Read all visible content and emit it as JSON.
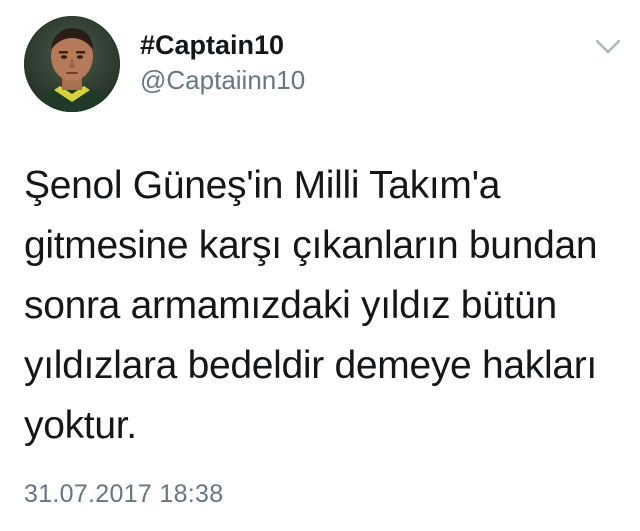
{
  "user": {
    "display_name": "#Captain10",
    "handle": "@Captaiinn10"
  },
  "tweet": {
    "lines": [
      "Şenol Güneş'in Milli Takım'a",
      "gitmesine karşı çıkanların bundan",
      "sonra armamızdaki yıldız bütün",
      "yıldızlara bedeldir demeye hakları",
      "yoktur."
    ],
    "timestamp": "31.07.2017 18:38"
  },
  "icons": {
    "menu": "chevron-down-icon"
  },
  "colors": {
    "text": "#14171a",
    "secondary": "#657786",
    "chevron": "#aab8c2"
  }
}
